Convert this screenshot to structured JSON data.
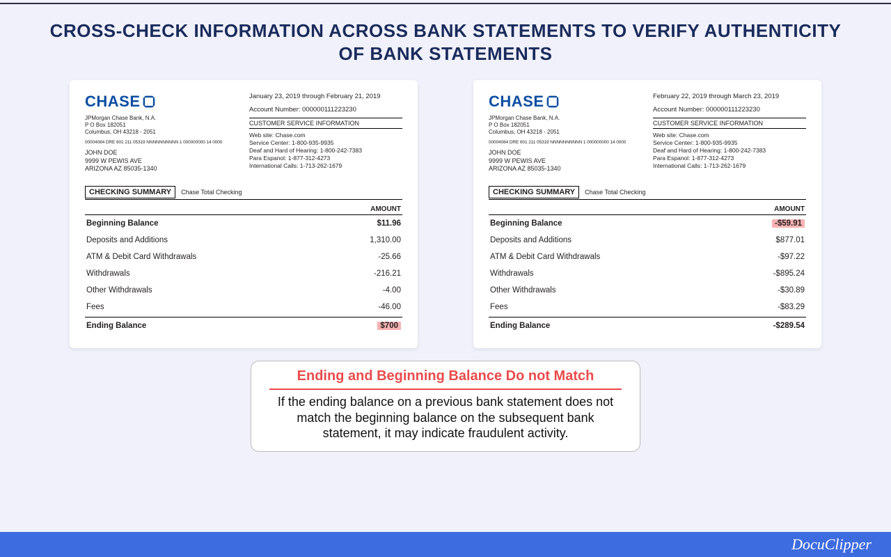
{
  "title": "CROSS-CHECK INFORMATION ACROSS BANK STATEMENTS TO VERIFY AUTHENTICITY OF BANK STATEMENTS",
  "footer_brand": "DocuClipper",
  "callout": {
    "title": "Ending and Beginning Balance Do not Match",
    "body": "If the ending balance on a previous bank statement does not match the beginning balance on the subsequent bank statement, it may indicate fraudulent activity."
  },
  "bank": {
    "logo_text": "CHASE",
    "company_name": "JPMorgan Chase Bank, N.A.",
    "po_box": "P O Box 182051",
    "city_state": "Columbus, OH 43218 - 2051",
    "micro": "00004084 DRE 601 211 05319 NNNNNNNNNN 1 000000000 14 0000",
    "summary_title": "CHECKING SUMMARY",
    "summary_sub": "Chase Total Checking",
    "amount_header": "AMOUNT",
    "service_header": "CUSTOMER SERVICE INFORMATION",
    "service_lines": {
      "website": "Web site: Chase.com",
      "center": "Service Center: 1-800-935-9935",
      "deaf": "Deaf and Hard of Hearing: 1-800-242-7383",
      "espanol": "Para Espanol: 1-877-312-4273",
      "intl": "International Calls: 1-713-262-1679"
    }
  },
  "customer": {
    "name": "JOHN DOE",
    "street": "9999 W PEWIS AVE",
    "city": "ARIZONA AZ 85035-1340"
  },
  "statements": [
    {
      "period": "January 23, 2019 through February 21, 2019",
      "account_number": "Account Number: 000000111223230",
      "rows": [
        {
          "label": "Beginning Balance",
          "amount": "$11.96",
          "bold": true,
          "highlight": false
        },
        {
          "label": "Deposits and Additions",
          "amount": "1,310.00",
          "bold": false,
          "highlight": false
        },
        {
          "label": "ATM & Debit Card Withdrawals",
          "amount": "-25.66",
          "bold": false,
          "highlight": false
        },
        {
          "label": "Withdrawals",
          "amount": "-216.21",
          "bold": false,
          "highlight": false
        },
        {
          "label": "Other Withdrawals",
          "amount": "-4.00",
          "bold": false,
          "highlight": false
        },
        {
          "label": "Fees",
          "amount": "-46.00",
          "bold": false,
          "highlight": false
        }
      ],
      "ending": {
        "label": "Ending Balance",
        "amount": "$700",
        "highlight": true
      }
    },
    {
      "period": "February 22, 2019 through March 23, 2019",
      "account_number": "Account Number: 000000111223230",
      "rows": [
        {
          "label": "Beginning Balance",
          "amount": "-$59.91",
          "bold": true,
          "highlight": true
        },
        {
          "label": "Deposits and Additions",
          "amount": "$877.01",
          "bold": false,
          "highlight": false
        },
        {
          "label": "ATM & Debit Card Withdrawals",
          "amount": "-$97.22",
          "bold": false,
          "highlight": false
        },
        {
          "label": "Withdrawals",
          "amount": "-$895.24",
          "bold": false,
          "highlight": false
        },
        {
          "label": "Other Withdrawals",
          "amount": "-$30.89",
          "bold": false,
          "highlight": false
        },
        {
          "label": "Fees",
          "amount": "-$83.29",
          "bold": false,
          "highlight": false
        }
      ],
      "ending": {
        "label": "Ending Balance",
        "amount": "-$289.54",
        "highlight": false
      }
    }
  ]
}
